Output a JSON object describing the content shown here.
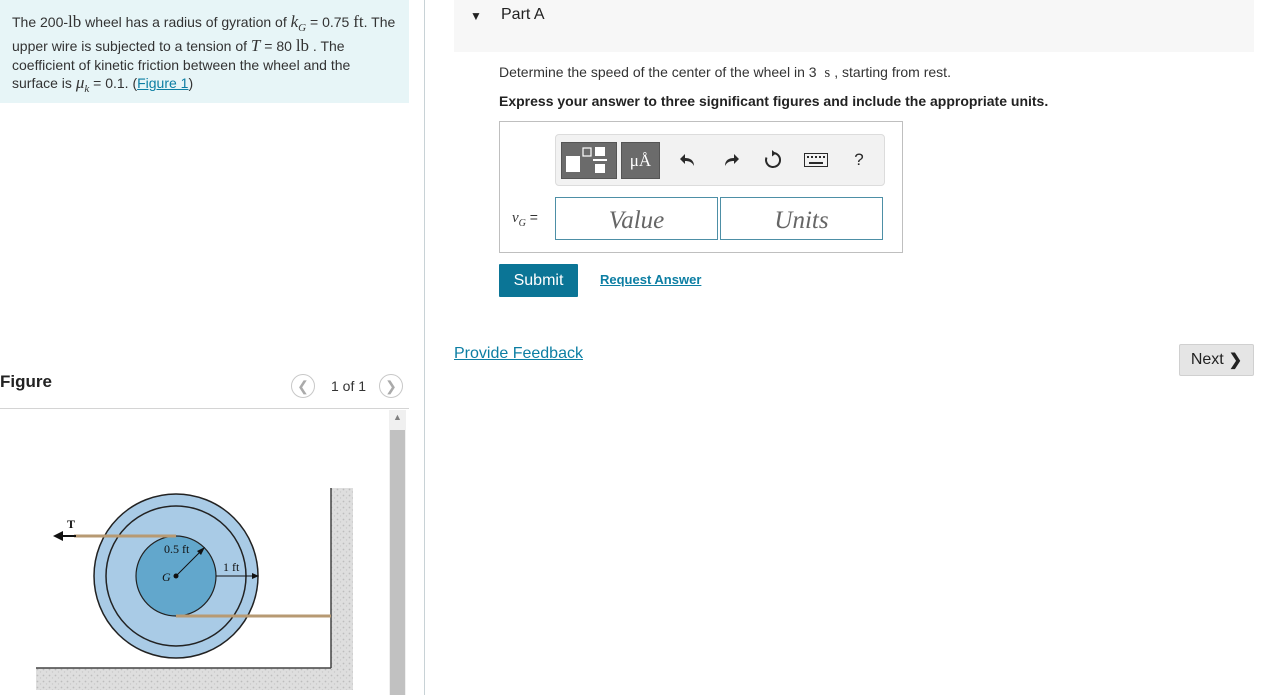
{
  "problem": {
    "t1": "The 200-",
    "weight_unit": "lb",
    "t2": " wheel has a radius of gyration of ",
    "k_sym": "k",
    "k_sub": "G",
    "t3": " = 0.75 ",
    "k_unit": "ft",
    "t4": ". The upper wire is subjected to a tension of ",
    "t_sym": "T",
    "t5": " = 80 ",
    "t_unit": "lb",
    "t6": " . The coefficient of kinetic friction between the wheel and the surface is ",
    "mu_sym": "μ",
    "mu_sub": "k",
    "t7": " = 0.1. (",
    "figure_link": "Figure 1",
    "t8": ")"
  },
  "figure": {
    "label": "Figure",
    "count": "1 of 1",
    "tension_label": "T",
    "inner_radius_label": "0.5 ft",
    "outer_radius_label": "1 ft",
    "center_label": "G"
  },
  "part": {
    "title": "Part A"
  },
  "question": {
    "text1": "Determine the speed of the center of the wheel in 3 ",
    "unit": "s",
    "text2": ", starting from rest.",
    "instruction": "Express your answer to three significant figures and include the appropriate units."
  },
  "answer": {
    "var_sym": "v",
    "var_sub": "G",
    "equals": " =",
    "value_placeholder": "Value",
    "units_placeholder": "Units",
    "mu_button": "μÅ",
    "help": "?"
  },
  "actions": {
    "submit": "Submit",
    "request": "Request Answer",
    "feedback": "Provide Feedback",
    "next": "Next"
  },
  "colors": {
    "accent": "#0b7596",
    "link": "#0c7ea3",
    "problem_bg": "#e7f5f7",
    "wheel_outer": "#a9cbe6",
    "wheel_inner": "#62a7cc"
  }
}
